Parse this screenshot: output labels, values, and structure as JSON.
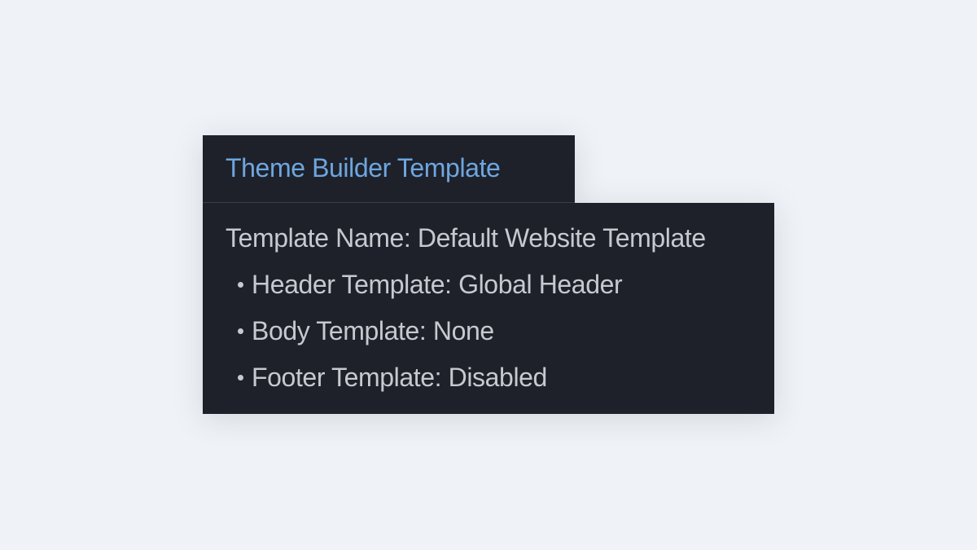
{
  "tooltip": {
    "title": "Theme Builder Template",
    "template_name_label": "Template Name:",
    "template_name_value": "Default Website Template",
    "items": [
      {
        "label": "Header Template:",
        "value": "Global Header"
      },
      {
        "label": "Body Template:",
        "value": "None"
      },
      {
        "label": "Footer Template:",
        "value": "Disabled"
      }
    ]
  },
  "colors": {
    "background": "#eff2f7",
    "panel": "#1e2129",
    "title_accent": "#6ea6e0",
    "text": "#c6c9cf"
  }
}
